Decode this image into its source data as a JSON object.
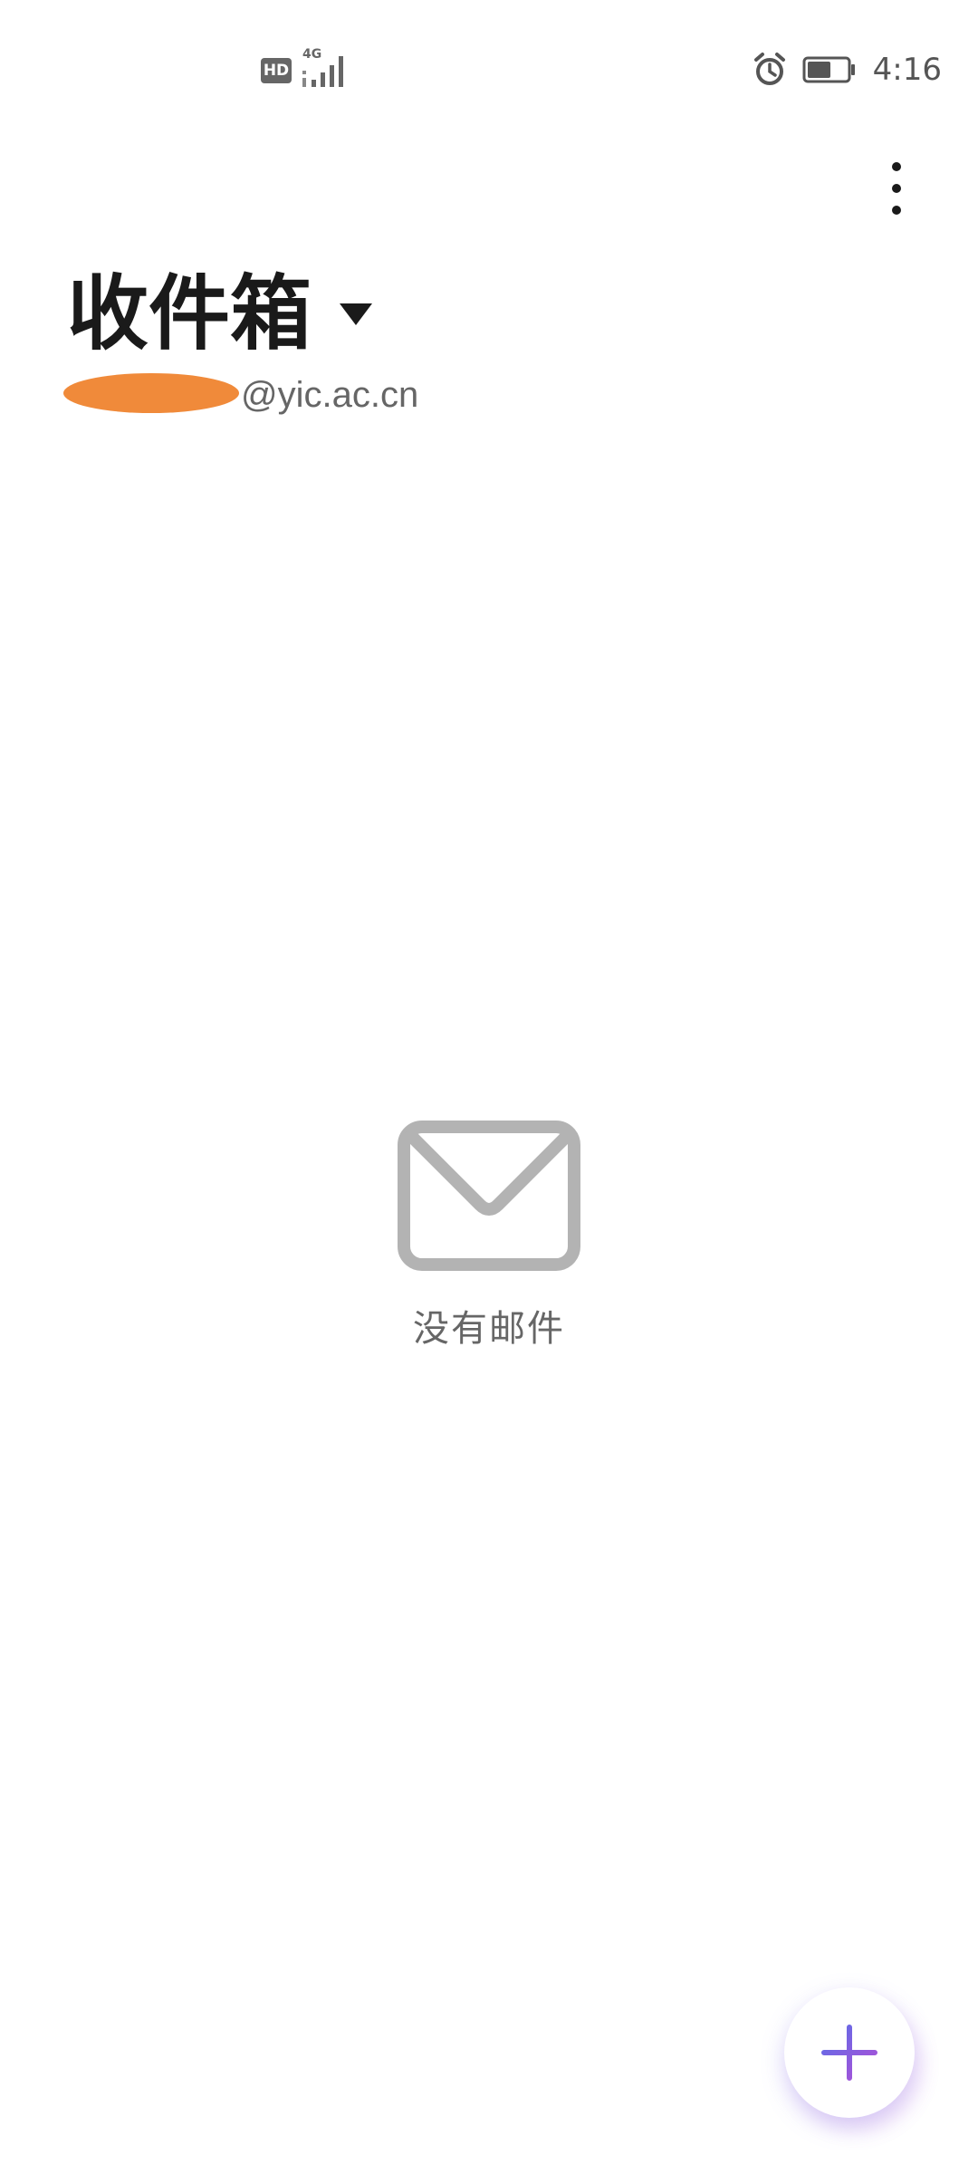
{
  "status_bar": {
    "hd_badge": "HD",
    "network": "4G",
    "time": "4:16",
    "battery_level": 0.6
  },
  "header": {
    "title": "收件箱",
    "account_email": "@yic.ac.cn"
  },
  "empty_state": {
    "message": "没有邮件"
  },
  "icons": {
    "overflow": "more-vertical-icon",
    "dropdown": "caret-down-icon",
    "empty": "envelope-icon",
    "compose": "plus-icon",
    "alarm": "alarm-icon",
    "battery": "battery-icon",
    "signal": "signal-icon"
  },
  "colors": {
    "accent_start": "#5b6ee8",
    "accent_end": "#b04fd6",
    "redaction": "#f08a3a",
    "icon_gray": "#b3b3b3",
    "text_primary": "#1a1a1a",
    "text_secondary": "#666666"
  }
}
